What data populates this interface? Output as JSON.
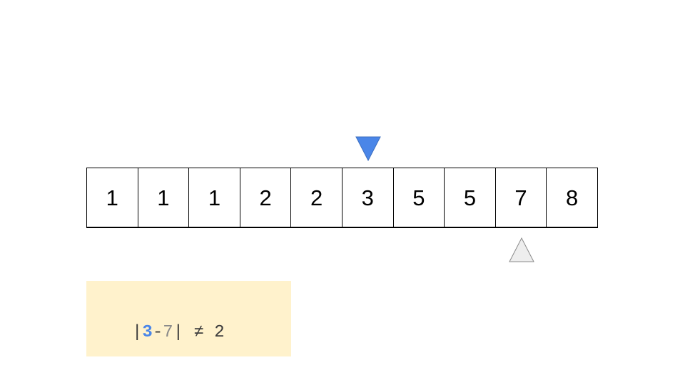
{
  "array": {
    "cells": [
      "1",
      "1",
      "1",
      "2",
      "2",
      "3",
      "5",
      "5",
      "7",
      "8"
    ]
  },
  "pointers": {
    "left": {
      "index": 5,
      "direction": "down",
      "color": "#4a86e8"
    },
    "right": {
      "index": 8,
      "direction": "up",
      "color": "#eeeeee"
    }
  },
  "formula": {
    "bar_open": "|",
    "left_value": "3",
    "minus": "-",
    "right_value": "7",
    "bar_close": "|",
    "relation": "≠",
    "target": "2",
    "background": "#fff2cc"
  }
}
